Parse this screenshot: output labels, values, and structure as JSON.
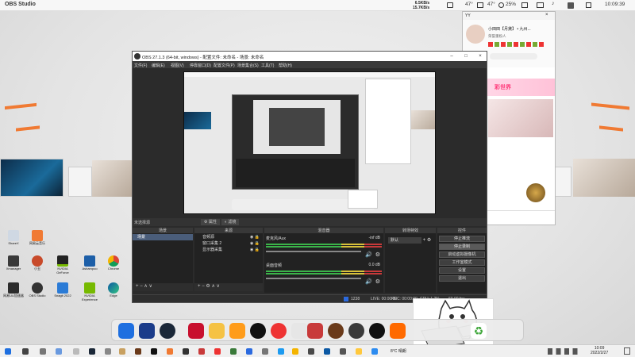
{
  "topbar": {
    "app_title": "OBS Studio",
    "net_up": "6.5KB/s",
    "net_down": "15.7KB/s",
    "cpu_temp": "47°",
    "gpu_temp": "47°",
    "battery": "25%",
    "clock": "10:09:39"
  },
  "obs": {
    "title": "OBS 27.1.3 (64-bit, windows) - 配置文件: 未命名 - 场景: 未命名",
    "menu": [
      "文件(F)",
      "编辑(E)",
      "视图(V)",
      "停靠窗口(D)",
      "配置文件(P)",
      "场景集合(S)",
      "工具(T)",
      "帮助(H)"
    ],
    "no_source_selected": "未选择源",
    "properties_btn": "属性",
    "filters_btn": "滤镜",
    "docks": {
      "scenes": "场景",
      "sources": "来源",
      "mixer": "混音器",
      "transitions": "转场特效",
      "controls": "控件"
    },
    "scene_item": "场景",
    "sources": [
      "音频源",
      "窗口采集 2",
      "显示器采集"
    ],
    "mixer_tracks": [
      {
        "name": "麦克风/Aux",
        "db": "-inf dB"
      },
      {
        "name": "桌面音频",
        "db": "0.0 dB"
      }
    ],
    "transition": "默认",
    "controls": [
      "停止推流",
      "停止录制",
      "启动虚拟摄像机",
      "工作室模式",
      "设置",
      "退出"
    ],
    "status": {
      "live": "LIVE: 00:00:00",
      "rec": "REC: 00:00:00",
      "cpu": "CPU: 1.2%",
      "fps": "60.00 fps",
      "kbps": "1238"
    }
  },
  "chat": {
    "header": "YY",
    "username": "小田田【月黛】 • 九州...",
    "subtitle": "荣誉重粉人",
    "banner": "彩世界"
  },
  "taskbar": {
    "weather": "8°C 晴朗",
    "time": "10:09",
    "date": "2022/2/27"
  },
  "desktop_icons": [
    "ShareX",
    "网易云音乐",
    "Xmanager",
    "小丑",
    "NVIDIA GeForce",
    "Ashampoo",
    "Chrome",
    "电脑管家",
    "NVIDIA Broadcast",
    "Battle.net",
    "网易UU加速器",
    "OBS Studio",
    "Snagit 2022",
    "NVIDIA Experience",
    "Edge"
  ],
  "colors": {
    "accent_orange": "#f07a33",
    "obs_bg": "#2b2b2b",
    "scene_selected": "#4a5d7a"
  }
}
